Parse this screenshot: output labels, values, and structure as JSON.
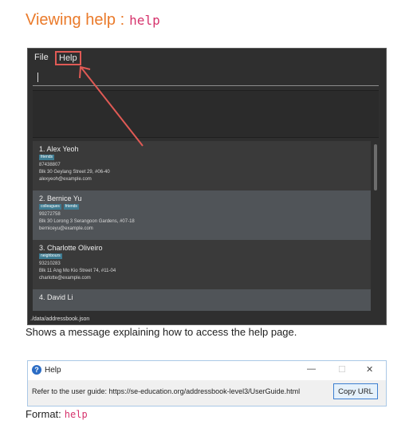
{
  "heading": {
    "text": "Viewing help :",
    "command": "help"
  },
  "app": {
    "menu": [
      "File",
      "Help"
    ],
    "persons": [
      {
        "name": "1. Alex Yeoh",
        "tags": [
          "friends"
        ],
        "phone": "87438807",
        "address": "Blk 30 Geylang Street 29, #06-40",
        "email": "alexyeoh@example.com"
      },
      {
        "name": "2. Bernice Yu",
        "tags": [
          "colleagues",
          "friends"
        ],
        "phone": "99272758",
        "address": "Blk 30 Lorong 3 Serangoon Gardens, #07-18",
        "email": "berniceyu@example.com"
      },
      {
        "name": "3. Charlotte Oliveiro",
        "tags": [
          "neighbours"
        ],
        "phone": "93210283",
        "address": "Blk 11 Ang Mo Kio Street 74, #11-04",
        "email": "charlotte@example.com"
      },
      {
        "name": "4. David Li",
        "tags": [],
        "phone": "",
        "address": "",
        "email": ""
      }
    ],
    "status_path": "./data/addressbook.json"
  },
  "caption": "Shows a message explaining how to access the help page.",
  "dialog": {
    "title": "Help",
    "minimize": "—",
    "maximize": "☐",
    "close": "✕",
    "message": "Refer to the user guide: https://se-education.org/addressbook-level3/UserGuide.html",
    "button": "Copy URL"
  },
  "format": {
    "label": "Format:",
    "command": "help"
  },
  "colors": {
    "heading": "#ea7a2a",
    "code": "#d6336c",
    "tag": "#3e7b91",
    "highlight_box": "#e05a55"
  }
}
